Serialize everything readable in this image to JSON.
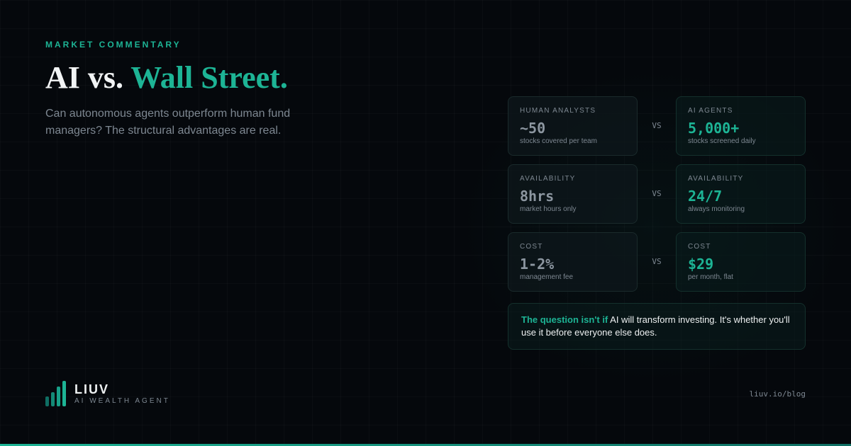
{
  "eyebrow": "MARKET COMMENTARY",
  "headline": {
    "part1": "AI vs. ",
    "accent": "Wall Street."
  },
  "subhead": "Can autonomous agents outperform human fund managers? The structural advantages are real.",
  "comparisons": [
    {
      "human": {
        "label": "HUMAN ANALYSTS",
        "value": "~50",
        "desc": "stocks covered per team"
      },
      "vs": "VS",
      "ai": {
        "label": "AI AGENTS",
        "value": "5,000+",
        "desc": "stocks screened daily"
      }
    },
    {
      "human": {
        "label": "AVAILABILITY",
        "value": "8hrs",
        "desc": "market hours only"
      },
      "vs": "VS",
      "ai": {
        "label": "AVAILABILITY",
        "value": "24/7",
        "desc": "always monitoring"
      }
    },
    {
      "human": {
        "label": "COST",
        "value": "1-2%",
        "desc": "management fee"
      },
      "vs": "VS",
      "ai": {
        "label": "COST",
        "value": "$29",
        "desc": "per month, flat"
      }
    }
  ],
  "quote": {
    "lead": "The question isn't if",
    "rest": " AI will transform investing. It's whether you'll use it before everyone else does."
  },
  "brand": {
    "name": "LIUV",
    "tagline": "AI WEALTH AGENT",
    "logo_icon": "bar-chart-logo-icon"
  },
  "url": "liuv.io/blog",
  "colors": {
    "accent": "#1db495",
    "background": "#05080c",
    "muted": "#7d8791"
  }
}
